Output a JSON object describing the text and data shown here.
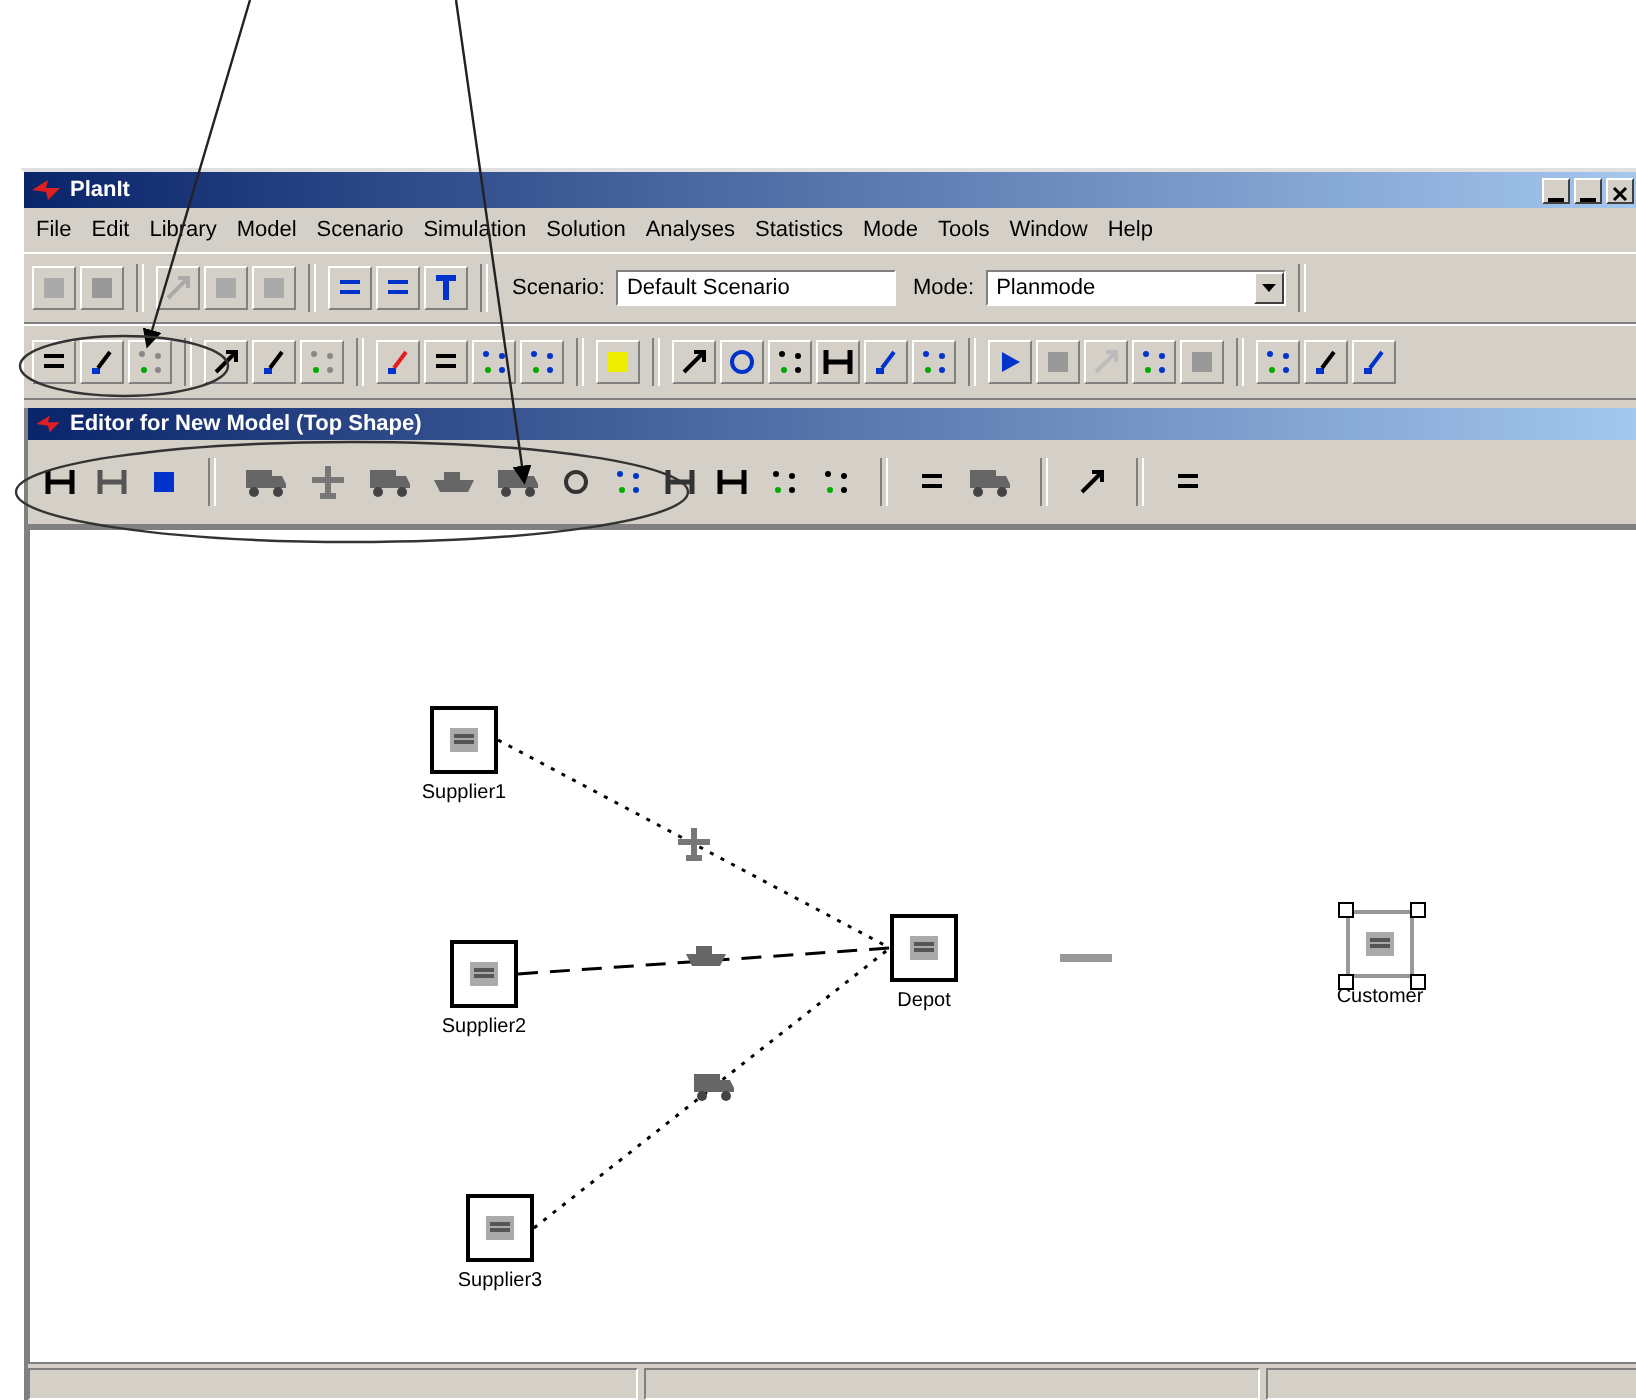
{
  "window": {
    "title": "PlanIt"
  },
  "menu": [
    "File",
    "Edit",
    "Library",
    "Model",
    "Scenario",
    "Simulation",
    "Solution",
    "Analyses",
    "Statistics",
    "Mode",
    "Tools",
    "Window",
    "Help"
  ],
  "toolbar": {
    "scenario_label": "Scenario:",
    "scenario_value": "Default Scenario",
    "mode_label": "Mode:",
    "mode_value": "Planmode"
  },
  "editor": {
    "title": "Editor for New Model (Top Shape)"
  },
  "nodes": [
    {
      "label": "Supplier1",
      "selected": false
    },
    {
      "label": "Supplier2",
      "selected": false
    },
    {
      "label": "Supplier3",
      "selected": false
    },
    {
      "label": "Depot",
      "selected": false
    },
    {
      "label": "Customer",
      "selected": true
    }
  ]
}
